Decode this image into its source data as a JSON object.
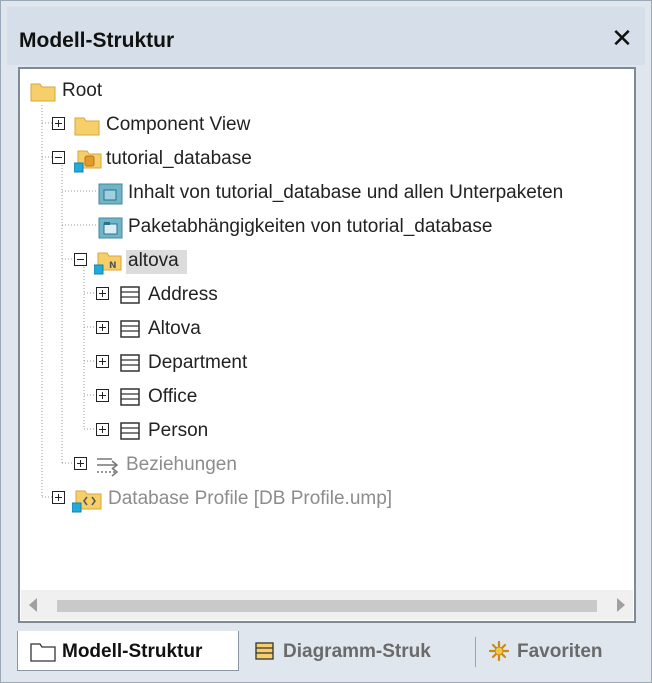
{
  "window": {
    "title": "Modell-Struktur"
  },
  "tree": {
    "root": "Root",
    "component_view": "Component View",
    "tutorial_database": "tutorial_database",
    "inhalt": "Inhalt von tutorial_database und allen Unterpaketen",
    "paketabh": "Paketabhängigkeiten von tutorial_database",
    "altova_pkg": "altova",
    "tables": [
      "Address",
      "Altova",
      "Department",
      "Office",
      "Person"
    ],
    "beziehungen": "Beziehungen",
    "db_profile": "Database Profile [DB Profile.ump]"
  },
  "tabs": [
    {
      "label": "Modell-Struktur",
      "icon": "folder-icon",
      "active": true
    },
    {
      "label": "Diagramm-Struk",
      "icon": "diagram-tree-icon",
      "active": false
    },
    {
      "label": "Favoriten",
      "icon": "star-icon",
      "active": false
    }
  ],
  "colors": {
    "folder": "#f6cf6a",
    "folder_edge": "#d9a63a",
    "diagram": "#6fb4c9",
    "package_overlay": "#22aadd"
  }
}
